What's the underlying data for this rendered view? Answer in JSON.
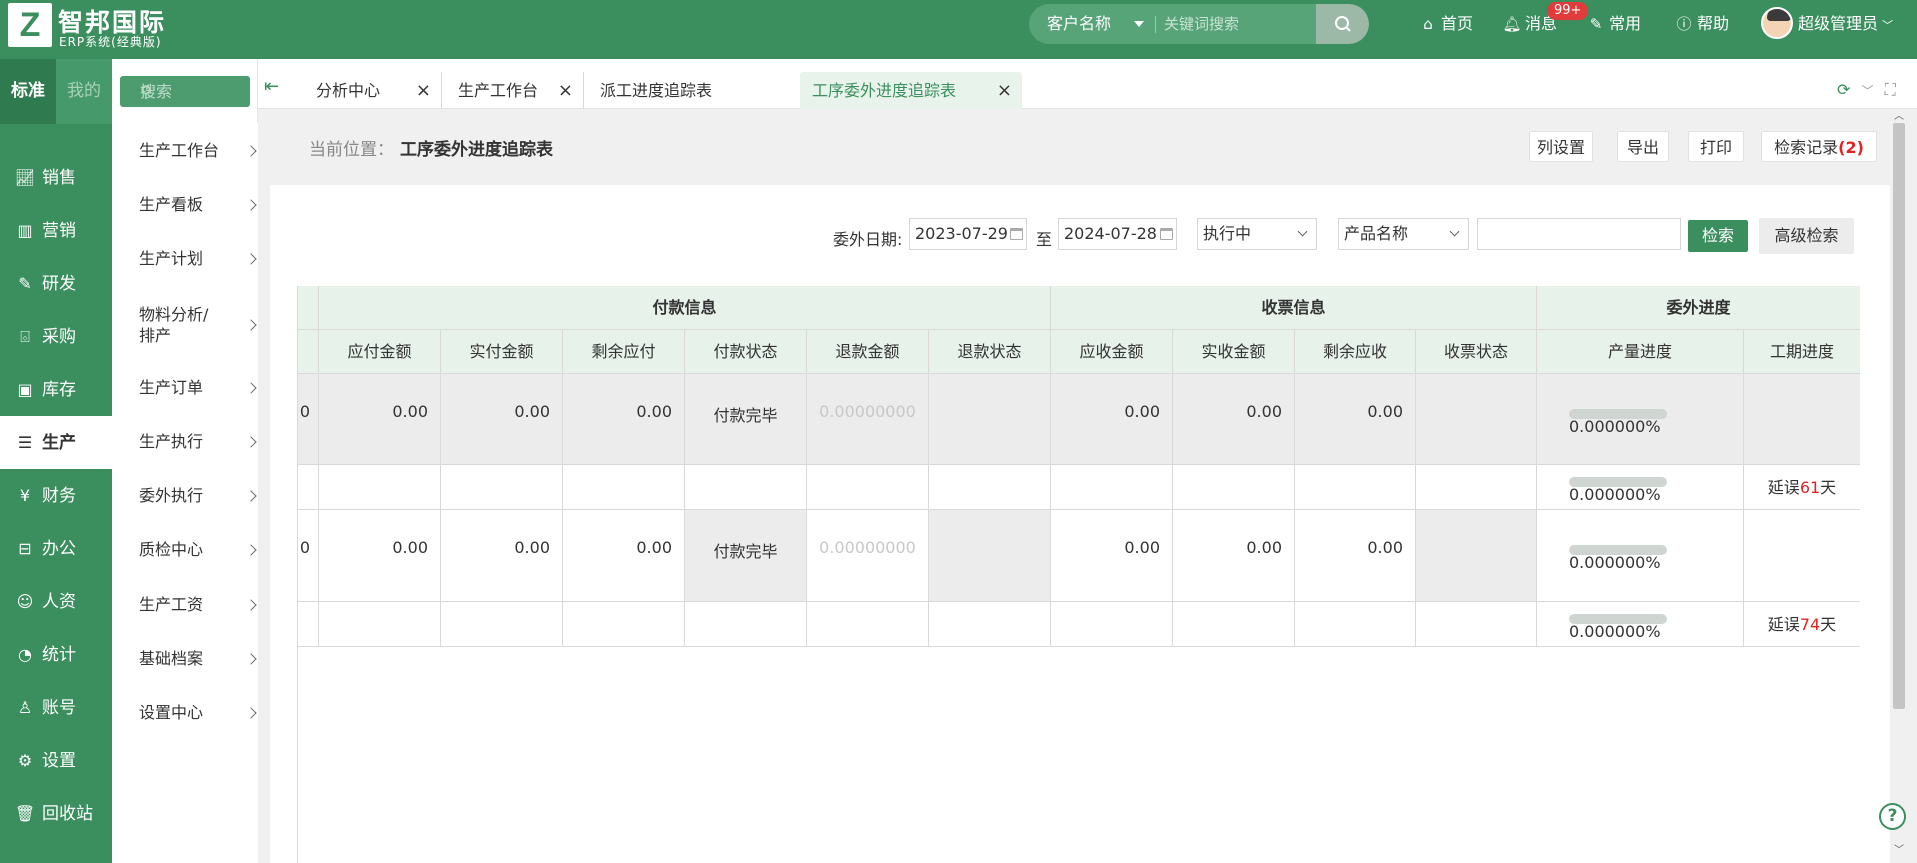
{
  "brand": {
    "logo_letter": "Z",
    "name": "智邦国际",
    "subtitle": "ERP系统(经典版)"
  },
  "search": {
    "scope": "客户名称",
    "placeholder": "关键词搜索"
  },
  "topnav": {
    "home": "首页",
    "messages": "消息",
    "messages_badge": "99+",
    "favorites": "常用",
    "help": "帮助",
    "user": "超级管理员"
  },
  "sidebar": {
    "tab_standard": "标准",
    "tab_mine": "我的",
    "items": [
      {
        "label": "销售"
      },
      {
        "label": "营销"
      },
      {
        "label": "研发"
      },
      {
        "label": "采购"
      },
      {
        "label": "库存"
      },
      {
        "label": "生产"
      },
      {
        "label": "财务"
      },
      {
        "label": "办公"
      },
      {
        "label": "人资"
      },
      {
        "label": "统计"
      },
      {
        "label": "账号"
      },
      {
        "label": "设置"
      },
      {
        "label": "回收站"
      }
    ],
    "active": "生产"
  },
  "subnav": {
    "search_placeholder": "搜索",
    "items": [
      {
        "label": "生产工作台"
      },
      {
        "label": "生产看板"
      },
      {
        "label": "生产计划"
      },
      {
        "label": "物料分析/排产"
      },
      {
        "label": "生产订单"
      },
      {
        "label": "生产执行"
      },
      {
        "label": "委外执行"
      },
      {
        "label": "质检中心"
      },
      {
        "label": "生产工资"
      },
      {
        "label": "基础档案"
      },
      {
        "label": "设置中心"
      }
    ]
  },
  "tabs": [
    {
      "label": "分析中心"
    },
    {
      "label": "生产工作台"
    },
    {
      "label": "派工进度追踪表"
    },
    {
      "label": "工序委外进度追踪表"
    }
  ],
  "active_tab": "工序委外进度追踪表",
  "breadcrumb": {
    "prefix": "当前位置：",
    "current": "工序委外进度追踪表"
  },
  "toolbar": {
    "columns": "列设置",
    "export": "导出",
    "print": "打印",
    "history": "检索记录",
    "history_count": "(2)"
  },
  "filter": {
    "date_label": "委外日期:",
    "date_from": "2023-07-29",
    "to_label": "至",
    "date_to": "2024-07-28",
    "status": "执行中",
    "field": "产品名称",
    "keyword": "",
    "search_btn": "检索",
    "advanced_btn": "高级检索"
  },
  "table": {
    "groups": {
      "payment": "付款信息",
      "receipt": "收票信息",
      "progress": "委外进度"
    },
    "columns": [
      "应付金额",
      "实付金额",
      "剩余应付",
      "付款状态",
      "退款金额",
      "退款状态",
      "应收金额",
      "实收金额",
      "剩余应收",
      "收票状态",
      "产量进度",
      "工期进度"
    ],
    "rows": [
      {
        "lead": "0",
        "payable": "0.00",
        "paid": "0.00",
        "remain_pay": "0.00",
        "pay_status": "付款完毕",
        "refund": "0.00000000",
        "refund_status": "",
        "receivable": "0.00",
        "received": "0.00",
        "remain_recv": "0.00",
        "invoice_status": "",
        "qty_progress": "0.000000%",
        "schedule_prefix": "",
        "schedule_days": "",
        "schedule_suffix": ""
      },
      {
        "lead": "",
        "payable": "",
        "paid": "",
        "remain_pay": "",
        "pay_status": "",
        "refund": "",
        "refund_status": "",
        "receivable": "",
        "received": "",
        "remain_recv": "",
        "invoice_status": "",
        "qty_progress": "0.000000%",
        "schedule_prefix": "延误",
        "schedule_days": "61",
        "schedule_suffix": "天"
      },
      {
        "lead": "0",
        "payable": "0.00",
        "paid": "0.00",
        "remain_pay": "0.00",
        "pay_status": "付款完毕",
        "refund": "0.00000000",
        "refund_status": "",
        "receivable": "0.00",
        "received": "0.00",
        "remain_recv": "0.00",
        "invoice_status": "",
        "qty_progress": "0.000000%",
        "schedule_prefix": "",
        "schedule_days": "",
        "schedule_suffix": ""
      },
      {
        "lead": "",
        "payable": "",
        "paid": "",
        "remain_pay": "",
        "pay_status": "",
        "refund": "",
        "refund_status": "",
        "receivable": "",
        "received": "",
        "remain_recv": "",
        "invoice_status": "",
        "qty_progress": "0.000000%",
        "schedule_prefix": "延误",
        "schedule_days": "74",
        "schedule_suffix": "天"
      }
    ]
  },
  "colors": {
    "brand": "#3b8f5e",
    "tab_active_bg": "#e8f3ec",
    "header_bg": "#e6f2ea",
    "danger": "#e02424"
  }
}
